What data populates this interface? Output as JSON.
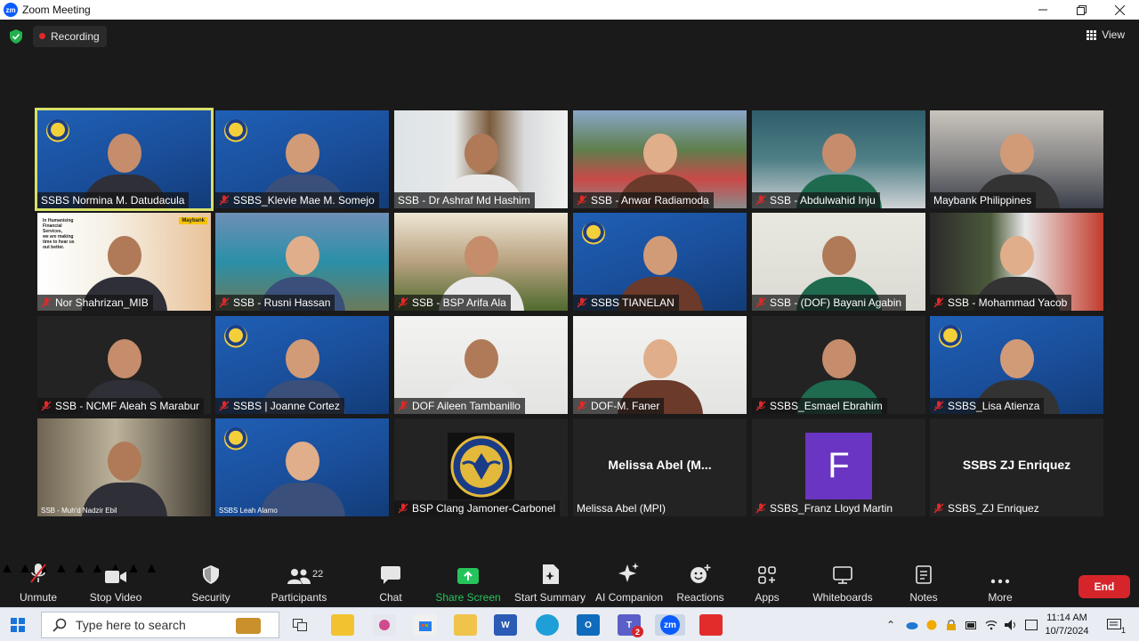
{
  "window": {
    "app_icon": "zm",
    "title": "Zoom Meeting",
    "minimize_icon": "minimize-icon",
    "maximize_icon": "restore-icon",
    "close_icon": "close-icon"
  },
  "topbar": {
    "security_status_icon": "shield-check-icon",
    "recording_label": "Recording",
    "view_label": "View"
  },
  "participants_grid": [
    {
      "name": "SSBS Normina M. Datudacula",
      "muted": false,
      "active_speaker": true,
      "bg": "blue"
    },
    {
      "name": "SSBS_Klevie Mae M. Somejo",
      "muted": true,
      "bg": "blue"
    },
    {
      "name": "SSB - Dr Ashraf Md Hashim",
      "muted": false,
      "bg": "office"
    },
    {
      "name": "SSB - Anwar Radiamoda",
      "muted": true,
      "bg": "outdoor"
    },
    {
      "name": "SSB - Abdulwahid Inju",
      "muted": true,
      "bg": "building"
    },
    {
      "name": "Maybank Philippines",
      "muted": false,
      "bg": "room"
    },
    {
      "name": "Nor Shahrizan_MIB",
      "muted": true,
      "bg": "maybank",
      "overlay_text": [
        "In Humanising",
        "Financial",
        "Services,",
        "we are making",
        "time to hear us",
        "out better."
      ],
      "brand": "Maybank"
    },
    {
      "name": "SSB - Rusni Hassan",
      "muted": true,
      "bg": "campus"
    },
    {
      "name": "SSB - BSP Arifa Ala",
      "muted": true,
      "bg": "indoor"
    },
    {
      "name": "SSBS TIANELAN",
      "muted": true,
      "bg": "blue"
    },
    {
      "name": "SSB - (DOF) Bayani Agabin",
      "muted": true,
      "bg": "light"
    },
    {
      "name": "SSB - Mohammad Yacob",
      "muted": true,
      "bg": "office2"
    },
    {
      "name": "SSB - NCMF Aleah S Marabur",
      "muted": true,
      "bg": "dark"
    },
    {
      "name": "SSBS | Joanne Cortez",
      "muted": true,
      "bg": "blue"
    },
    {
      "name": "DOF Aileen Tambanillo",
      "muted": true,
      "bg": "white"
    },
    {
      "name": "DOF-M. Faner",
      "muted": true,
      "bg": "white"
    },
    {
      "name": "SSBS_Esmael Ebrahim",
      "muted": true,
      "bg": "dark"
    },
    {
      "name": "SSBS_Lisa Atienza",
      "muted": true,
      "bg": "blue"
    },
    {
      "name": "SSB - Muh'd Nadzir Ebil",
      "muted": false,
      "small_label": true,
      "bg": "home"
    },
    {
      "name": "SSBS Leah Alamo",
      "muted": false,
      "small_label": true,
      "bg": "blue"
    },
    {
      "name": "BSP Clang Jamoner-Carbonel",
      "muted": true,
      "bg": "seal"
    },
    {
      "name": "Melissa Abel (MPI)",
      "muted": false,
      "display": "Melissa Abel (M...",
      "bg": "none"
    },
    {
      "name": "SSBS_Franz Lloyd Martin",
      "muted": true,
      "avatar_letter": "F",
      "bg": "none"
    },
    {
      "name": "SSBS_ZJ Enriquez",
      "muted": true,
      "display": "SSBS ZJ Enriquez",
      "bg": "none"
    }
  ],
  "toolbar": {
    "unmute": "Unmute",
    "stop_video": "Stop Video",
    "security": "Security",
    "participants": "Participants",
    "participants_count": "22",
    "chat": "Chat",
    "share_screen": "Share Screen",
    "start_summary": "Start Summary",
    "ai_companion": "AI Companion",
    "reactions": "Reactions",
    "apps": "Apps",
    "whiteboards": "Whiteboards",
    "notes": "Notes",
    "more": "More",
    "end": "End"
  },
  "taskbar": {
    "search_placeholder": "Type here to search",
    "apps": [
      "file-explorer",
      "task-view",
      "sticky-notes",
      "snipping",
      "store",
      "folder",
      "word",
      "edge",
      "outlook",
      "teams",
      "zoom",
      "acrobat"
    ],
    "teams_badge": "2",
    "time": "11:14 AM",
    "date": "10/7/2024",
    "notification_count": "1"
  },
  "colors": {
    "accent_green": "#25c45a",
    "end_red": "#d6242b",
    "active_speaker": "#d8e06a",
    "zoom_blue": "#0b5cff"
  }
}
